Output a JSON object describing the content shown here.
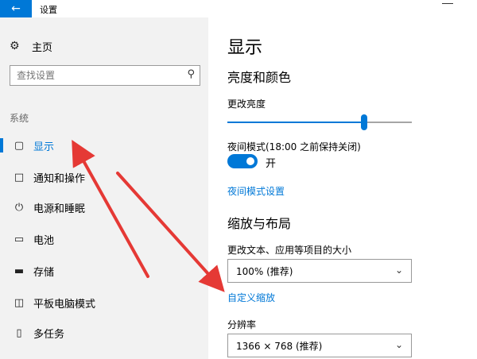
{
  "titlebar": {
    "title": "设置",
    "back_icon": "arrow-left-icon"
  },
  "sidebar": {
    "home_label": "主页",
    "home_icon": "gear-icon",
    "search_placeholder": "查找设置",
    "section": "系统",
    "items": [
      {
        "label": "显示",
        "icon": "monitor-icon",
        "selected": true
      },
      {
        "label": "通知和操作",
        "icon": "notification-icon",
        "selected": false
      },
      {
        "label": "电源和睡眠",
        "icon": "power-icon",
        "selected": false
      },
      {
        "label": "电池",
        "icon": "battery-icon",
        "selected": false
      },
      {
        "label": "存储",
        "icon": "storage-icon",
        "selected": false
      },
      {
        "label": "平板电脑模式",
        "icon": "tablet-mode-icon",
        "selected": false
      },
      {
        "label": "多任务",
        "icon": "multitask-icon",
        "selected": false
      }
    ]
  },
  "main": {
    "title": "显示",
    "section_brightness": "亮度和颜色",
    "brightness_label": "更改亮度",
    "brightness_level": 0.74,
    "night_mode_label": "夜间模式(18:00 之前保持关闭)",
    "night_mode_state": "开",
    "night_mode_settings_link": "夜间模式设置",
    "section_scale": "缩放与布局",
    "scale_label": "更改文本、应用等项目的大小",
    "scale_value": "100% (推荐)",
    "custom_scaling_link": "自定义缩放",
    "resolution_label": "分辨率",
    "resolution_value": "1366 × 768 (推荐)"
  },
  "colors": {
    "accent": "#0078d7",
    "annotation_arrow": "#e53935"
  }
}
